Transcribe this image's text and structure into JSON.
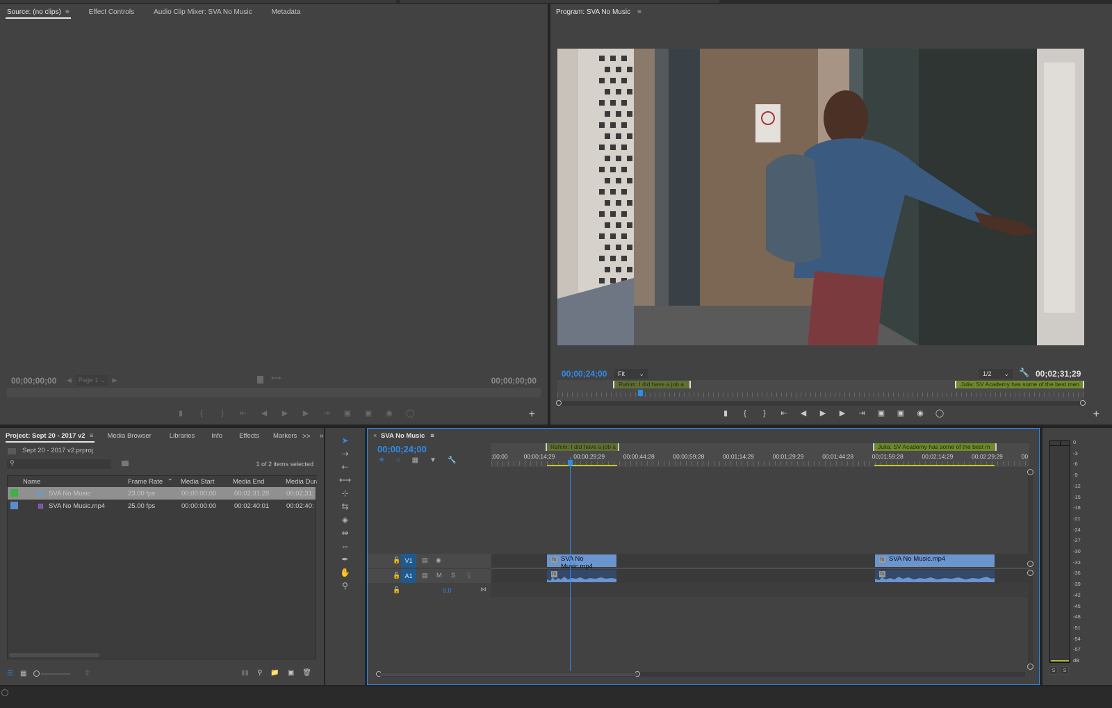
{
  "source_monitor": {
    "tabs": [
      {
        "label": "Source: (no clips)",
        "active": true
      },
      {
        "label": "Effect Controls",
        "active": false
      },
      {
        "label": "Audio Clip Mixer: SVA No Music",
        "active": false
      },
      {
        "label": "Metadata",
        "active": false
      }
    ],
    "timecode_in": "00;00;00;00",
    "timecode_out": "00;00;00;00",
    "page_label": "Page 1",
    "add_label": "+"
  },
  "program_monitor": {
    "title": "Program: SVA No Music",
    "timecode_current": "00;00;24;00",
    "fit_label": "Fit",
    "resolution_label": "1/2",
    "timecode_duration": "00;02;31;29",
    "markers": [
      {
        "label": "Rahim: I did have a job a"
      },
      {
        "label": "Julia: SV Academy has some of the best men"
      }
    ],
    "add_label": "+"
  },
  "project_panel": {
    "tabs": [
      {
        "label": "Project: Sept 20 - 2017 v2",
        "active": true
      },
      {
        "label": "Media Browser",
        "active": false
      },
      {
        "label": "Libraries",
        "active": false
      },
      {
        "label": "Info",
        "active": false
      },
      {
        "label": "Effects",
        "active": false
      },
      {
        "label": "Markers",
        "active": false
      }
    ],
    "overflow_label": ">>",
    "project_file": "Sept 20 - 2017 v2.prproj",
    "search_placeholder": "",
    "selection_status": "1 of 2 items selected",
    "columns": [
      "Name",
      "Frame Rate",
      "Media Start",
      "Media End",
      "Media Dura"
    ],
    "rows": [
      {
        "color": "#3fb043",
        "name": "SVA No Music",
        "type": "sequence",
        "frame_rate": "23.00 fps",
        "media_start": "00;00;00;00",
        "media_end": "00;02;31;28",
        "media_duration": "00;02;31;",
        "selected": true
      },
      {
        "color": "#5b8bd0",
        "name": "SVA No Music.mp4",
        "type": "clip",
        "frame_rate": "25.00 fps",
        "media_start": "00:00:00:00",
        "media_end": "00:02:40:01",
        "media_duration": "00:02:40:",
        "selected": false
      }
    ]
  },
  "timeline": {
    "sequence_name": "SVA No Music",
    "close_label": "×",
    "playhead_timecode": "00;00;24;00",
    "ruler_labels": [
      ";00;00",
      "00;00;14;29",
      "00;00;29;29",
      "00;00;44;28",
      "00;00;59;28",
      "00;01;14;29",
      "00;01;29;29",
      "00;01;44;28",
      "00;01;59;28",
      "00;02;14;29",
      "00;02;29;29",
      "00"
    ],
    "markers": [
      {
        "label": "Rahim: I did have a job a"
      },
      {
        "label": "Julia: SV Academy has some of the best m"
      }
    ],
    "tracks": {
      "video": {
        "label": "V1"
      },
      "audio": {
        "label": "A1",
        "mute": "M",
        "solo": "S"
      },
      "master_value": "0.0"
    },
    "clips": [
      {
        "name": "SVA No Music.mp4",
        "fx": "fx"
      },
      {
        "name": "SVA No Music.mp4",
        "fx": "fx"
      }
    ]
  },
  "audio_meter": {
    "scale": [
      "0",
      "-3",
      "-6",
      "-9",
      "-12",
      "-15",
      "-18",
      "-21",
      "-24",
      "-27",
      "-30",
      "-33",
      "-36",
      "-39",
      "-42",
      "-45",
      "-48",
      "-51",
      "-54",
      "-57",
      "dB"
    ],
    "solo_buttons": [
      "S",
      "S"
    ]
  }
}
